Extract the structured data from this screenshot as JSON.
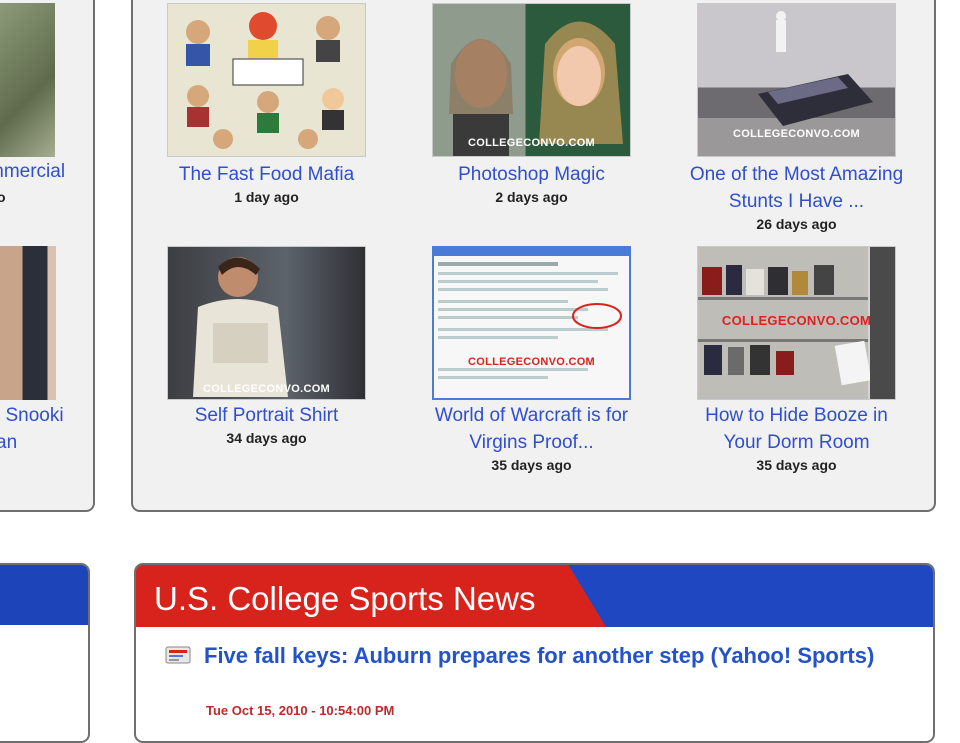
{
  "left_column": {
    "items": [
      {
        "title": "mmercial",
        "age": "o"
      },
      {
        "title": "l Snooki\nan",
        "age": ""
      }
    ]
  },
  "videos": [
    {
      "title": "The Fast Food Mafia",
      "age": "1 day ago",
      "watermark": ""
    },
    {
      "title": "Photoshop Magic",
      "age": "2 days ago",
      "watermark": "COLLEGECONVO.COM"
    },
    {
      "title": "One of the Most Amazing Stunts I Have ...",
      "age": "26 days ago",
      "watermark": "COLLEGECONVO.COM"
    },
    {
      "title": "Self Portrait Shirt",
      "age": "34 days ago",
      "watermark": "COLLEGECONVO.COM"
    },
    {
      "title": "World of Warcraft is for Virgins Proof...",
      "age": "35 days ago",
      "watermark": "COLLEGECONVO.COM"
    },
    {
      "title": "How to Hide Booze in Your Dorm Room",
      "age": "35 days ago",
      "watermark": "COLLEGECONVO.COM"
    }
  ],
  "news": {
    "header": "U.S. College Sports News",
    "items": [
      {
        "title": "Five fall keys: Auburn prepares for another step (Yahoo! Sports)",
        "date": "Tue Oct 15, 2010 - 10:54:00 PM"
      }
    ]
  },
  "colors": {
    "link": "#2f4fce",
    "header_red": "#d8231c",
    "header_blue": "#1e47c1",
    "date_red": "#c0282b"
  }
}
